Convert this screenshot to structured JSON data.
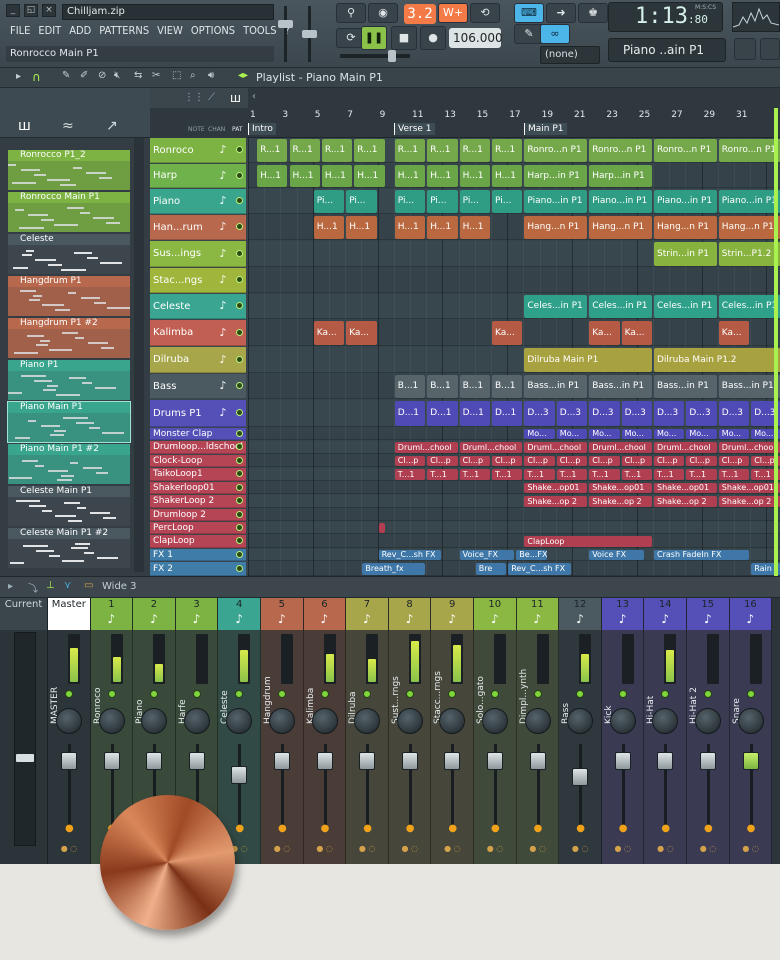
{
  "window": {
    "filename": "Chilljam.zip",
    "hint": "Ronrocco Main P1",
    "menu": [
      "FILE",
      "EDIT",
      "ADD",
      "PATTERNS",
      "VIEW",
      "OPTIONS",
      "TOOLS",
      "?"
    ]
  },
  "transport": {
    "pattern_number": "3.2",
    "tempo": "106.000",
    "time": "1:13",
    "time_small": ":80",
    "time_units": "M:S:CS",
    "pattern_selector": "Piano ..ain P1",
    "none_selector": "(none)"
  },
  "playlist": {
    "title": "Playlist - Piano Main P1",
    "header_tabs": [
      "NOTE",
      "CHAN",
      "PAT"
    ],
    "bars": [
      "1",
      "3",
      "5",
      "7",
      "9",
      "11",
      "13",
      "15",
      "17",
      "19",
      "21",
      "23",
      "25",
      "27",
      "29",
      "31"
    ],
    "markers": [
      {
        "label": "Intro"
      },
      {
        "label": "Verse 1"
      },
      {
        "label": "Main P1"
      }
    ]
  },
  "pattern_list": [
    {
      "label": "Ronrocco P1_2",
      "color": "#7cb342"
    },
    {
      "label": "Ronrocco Main P1",
      "color": "#7cb342"
    },
    {
      "label": "Celeste",
      "color": "#4a5860"
    },
    {
      "label": "Hangdrum P1",
      "color": "#b8684c"
    },
    {
      "label": "Hangdrum P1 #2",
      "color": "#b8684c"
    },
    {
      "label": "Piano P1",
      "color": "#3aa58d"
    },
    {
      "label": "Piano Main P1",
      "color": "#3aa58d"
    },
    {
      "label": "Piano Main P1 #2",
      "color": "#3aa58d"
    },
    {
      "label": "Celeste Main P1",
      "color": "#4a5860"
    },
    {
      "label": "Celeste Main P1 #2",
      "color": "#4a5860"
    }
  ],
  "tracks": [
    {
      "name": "Ronroco",
      "color": "#7cb342",
      "icon": "guitar-icon"
    },
    {
      "name": "Harp",
      "color": "#6fb14a",
      "icon": "harp-icon"
    },
    {
      "name": "Piano",
      "color": "#3aa58d",
      "icon": "piano-icon"
    },
    {
      "name": "Han...rum",
      "color": "#b8684c",
      "icon": "drum-icon"
    },
    {
      "name": "Sus...ings",
      "color": "#8bb743",
      "icon": "violin-icon"
    },
    {
      "name": "Stac...ngs",
      "color": "#9fb53b",
      "icon": "violin-icon"
    },
    {
      "name": "Celeste",
      "color": "#3aa590",
      "icon": "keyboard-icon"
    },
    {
      "name": "Kalimba",
      "color": "#c05f52",
      "icon": "kalimba-icon"
    },
    {
      "name": "Dilruba",
      "color": "#a8a64a",
      "icon": "violin-icon"
    },
    {
      "name": "Bass",
      "color": "#4a5a60",
      "icon": "bass-icon"
    },
    {
      "name": "Drums P1",
      "color": "#5450b8",
      "icon": "drumkit-icon"
    },
    {
      "name": "Monster Clap",
      "color": "#5450b8",
      "icon": ""
    },
    {
      "name": "Drumloop...ldschool",
      "color": "#b54455",
      "icon": ""
    },
    {
      "name": "Clock-Loop",
      "color": "#b54455",
      "icon": ""
    },
    {
      "name": "TaikoLoop1",
      "color": "#b54455",
      "icon": ""
    },
    {
      "name": "Shakerloop01",
      "color": "#b54455",
      "icon": ""
    },
    {
      "name": "ShakerLoop 2",
      "color": "#b54455",
      "icon": ""
    },
    {
      "name": "Drumloop 2",
      "color": "#b54455",
      "icon": ""
    },
    {
      "name": "PercLoop",
      "color": "#b54455",
      "icon": ""
    },
    {
      "name": "ClapLoop",
      "color": "#b54455",
      "icon": ""
    },
    {
      "name": "FX 1",
      "color": "#3f7ca8",
      "icon": ""
    },
    {
      "name": "FX 2",
      "color": "#3f7ca8",
      "icon": ""
    }
  ],
  "clip_labels": {
    "ronroco_intro": "R...1",
    "ronroco_main": "Ronro...n P1",
    "harp_intro": "H...1",
    "harp_main": "Harp...in P1",
    "piano_intro": "Pi...",
    "piano_main": "Piano...in P1",
    "piano_main2": "Pian...in P1",
    "hang_intro": "H...1",
    "hang_main": "Hang...n P1",
    "strings": "Strin...in P1",
    "strings2": "Strin...P1.2",
    "celeste": "Celes...in P1",
    "kalimba": "Ka...",
    "dilruba": "Dilruba Main P1",
    "dilruba2": "Dilruba Main P1.2",
    "bass_verse": "B...1",
    "bass_main": "Bass...in P1",
    "drums_verse": "D...1",
    "drums_main": "D...3",
    "monster": "Mo...",
    "drumloop": "Druml...chool",
    "clock": "Cl...p",
    "taiko": "T...1",
    "shaker": "Shake...op01",
    "shaker2": "Shake...op 2",
    "claploop": "ClapLoop",
    "fx_rev": "Rev_C...sh FX",
    "fx_voice": "Voice_FX",
    "fx_be": "Be...FX",
    "fx_voice2": "Voice FX",
    "fx_crash": "Crash FadeIn FX",
    "fx_breath": "Breath_fx",
    "fx_bre": "Bre",
    "fx_rev2": "Rev_C...sh FX",
    "fx_rain": "Rain"
  },
  "mixer": {
    "toolbar_label": "Wide 3",
    "current_label": "Current",
    "master_label": "Master",
    "channels": [
      {
        "num": "",
        "name": "MASTER",
        "color": "#ffffff",
        "bg": "#2c353a",
        "level": 0.75
      },
      {
        "num": "1",
        "name": "Ronroco",
        "color": "#7cb342",
        "bg": "#3a4a3a",
        "level": 0.55
      },
      {
        "num": "2",
        "name": "Piano",
        "color": "#7cb342",
        "bg": "#3a4a3a",
        "level": 0.4
      },
      {
        "num": "3",
        "name": "Harfe",
        "color": "#7cb342",
        "bg": "#3a4a3a",
        "level": 0.0
      },
      {
        "num": "4",
        "name": "Celeste",
        "color": "#3aa590",
        "bg": "#324a45",
        "level": 0.7
      },
      {
        "num": "5",
        "name": "Hangdrum",
        "color": "#b8684c",
        "bg": "#4a3c37",
        "level": 0.0
      },
      {
        "num": "6",
        "name": "Kalimba",
        "color": "#b8684c",
        "bg": "#4a3c37",
        "level": 0.6
      },
      {
        "num": "7",
        "name": "Dilruba",
        "color": "#a8a64a",
        "bg": "#46463a",
        "level": 0.5
      },
      {
        "num": "8",
        "name": "Sust...rngs",
        "color": "#a8a64a",
        "bg": "#46463a",
        "level": 0.9
      },
      {
        "num": "9",
        "name": "Stacc...rngs",
        "color": "#a8a64a",
        "bg": "#46463a",
        "level": 0.8
      },
      {
        "num": "10",
        "name": "Solo...gato",
        "color": "#8bb743",
        "bg": "#3f4a3a",
        "level": 0.0
      },
      {
        "num": "11",
        "name": "Dimpl...ynth",
        "color": "#8bb743",
        "bg": "#3f4a3a",
        "level": 0.0
      },
      {
        "num": "12",
        "name": "Bass",
        "color": "#4a5a60",
        "bg": "#2e383d",
        "level": 0.6
      },
      {
        "num": "13",
        "name": "Kick",
        "color": "#5450b8",
        "bg": "#3a3a52",
        "level": 0.0
      },
      {
        "num": "14",
        "name": "Hi-Hat",
        "color": "#5450b8",
        "bg": "#3a3a52",
        "level": 0.7
      },
      {
        "num": "15",
        "name": "Hi-Hat 2",
        "color": "#5450b8",
        "bg": "#3a3a52",
        "level": 0.0
      },
      {
        "num": "16",
        "name": "Snare",
        "color": "#5450b8",
        "bg": "#3a3a52",
        "level": 0.0
      }
    ]
  },
  "colors": {
    "accent_green": "#a9f14f",
    "accent_orange": "#f47a48",
    "panel": "#3a454c"
  }
}
